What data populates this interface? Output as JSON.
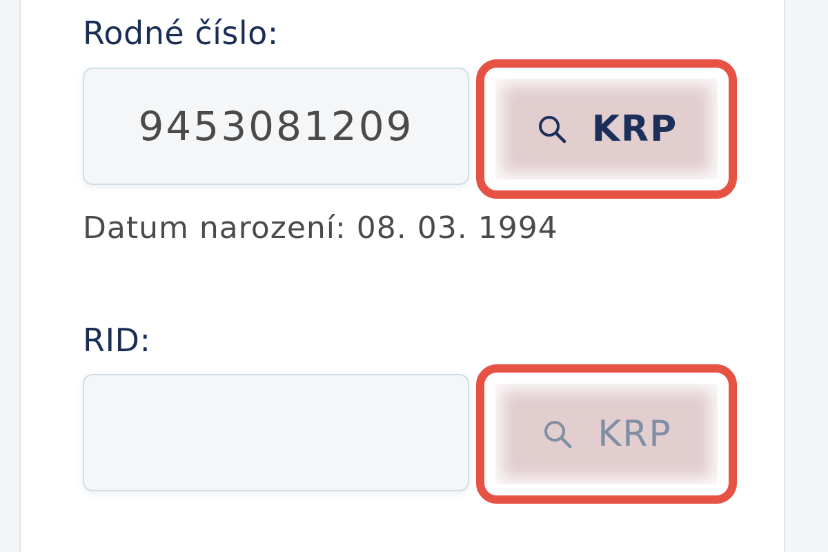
{
  "rodne_cislo": {
    "label": "Rodné číslo:",
    "value": "9453081209",
    "lookup_button": {
      "label": "KRP",
      "icon": "search-icon",
      "state": "enabled"
    }
  },
  "birth_date_text": "Datum narození: 08. 03. 1994",
  "rid": {
    "label": "RID:",
    "value": "",
    "lookup_button": {
      "label": "KRP",
      "icon": "search-icon",
      "state": "disabled"
    }
  },
  "colors": {
    "label_text": "#1a2e55",
    "highlight": "#e65244",
    "button_bg": "#e2cdcf",
    "button_text_active": "#1b2f5a",
    "button_text_disabled": "#7f8ea3"
  }
}
